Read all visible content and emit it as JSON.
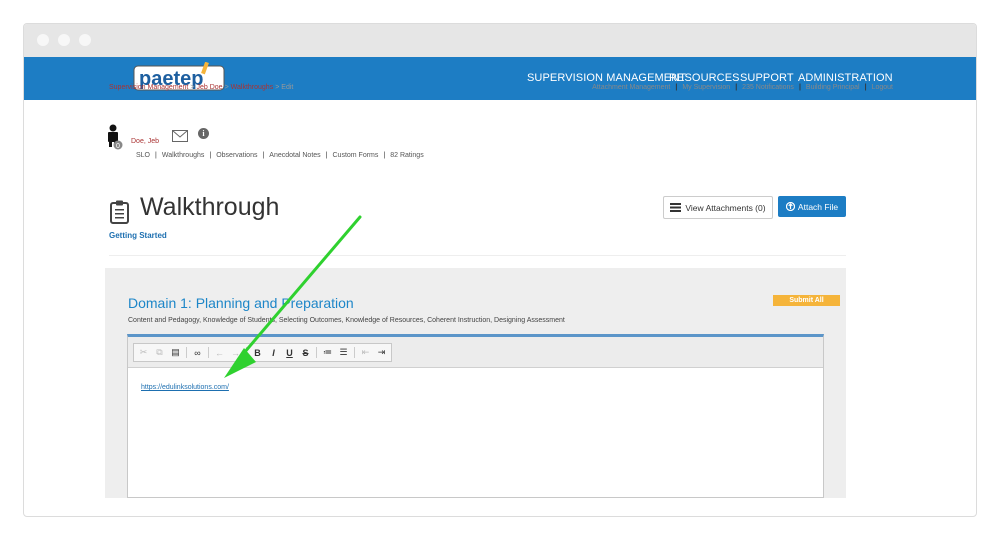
{
  "window": {
    "controls": [
      "close",
      "minimize",
      "maximize"
    ]
  },
  "logo": {
    "text": "paetep"
  },
  "nav": {
    "items": [
      "SUPERVISION MANAGEMENT",
      "RESOURCES",
      "SUPPORT",
      "ADMINISTRATION"
    ]
  },
  "breadcrumb": {
    "items": [
      "Supervision Management",
      "Jeb Doe",
      "Walkthroughs",
      "Edit"
    ],
    "separator": ">"
  },
  "top_links": [
    "Attachment Management",
    "My Supervision",
    "235 Notifications",
    "Building Principal",
    "Logout"
  ],
  "user": {
    "name": "Doe, Jeb",
    "badge": "0",
    "links": [
      "SLO",
      "Walkthroughs",
      "Observations",
      "Anecdotal Notes",
      "Custom Forms",
      "82 Ratings"
    ]
  },
  "page": {
    "title": "Walkthrough",
    "subtitle": "Getting Started"
  },
  "buttons": {
    "view_attachments": "View Attachments (0)",
    "attach_file": "Attach File",
    "submit_all": "Submit All"
  },
  "domain": {
    "title": "Domain 1: Planning and Preparation",
    "description": "Content and Pedagogy, Knowledge of Students, Selecting Outcomes, Knowledge of Resources, Coherent Instruction, Designing Assessment"
  },
  "editor": {
    "toolbar_icons": [
      "cut-icon",
      "copy-icon",
      "paste-icon",
      "link-icon",
      "undo-icon",
      "redo-icon",
      "bold-icon",
      "italic-icon",
      "underline-icon",
      "strikethrough-icon",
      "numbered-list-icon",
      "bulleted-list-icon",
      "outdent-icon",
      "indent-icon"
    ],
    "toolbar_labels": {
      "bold": "B",
      "italic": "I",
      "underline": "U",
      "strike": "S"
    },
    "content_link": "https://edulinksolutions.com/"
  },
  "annotation": {
    "arrow_color": "#2fd12f"
  },
  "colors": {
    "nav_bg": "#1d7dc4",
    "accent_link": "#1d86c8",
    "breadcrumb": "#aa3333",
    "submit": "#f5b43a"
  }
}
